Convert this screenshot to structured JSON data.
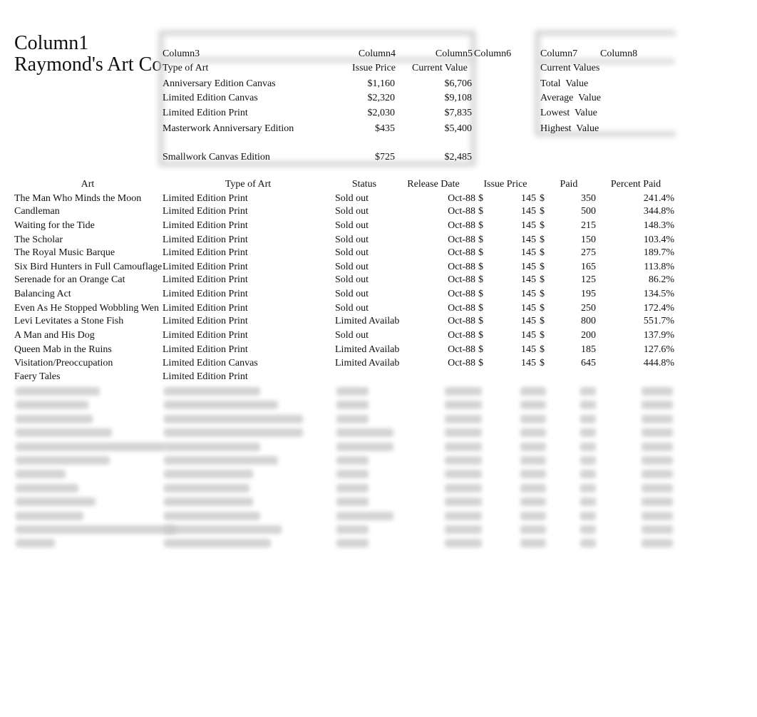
{
  "header": {
    "column1": "Column1",
    "company": "Raymond's Art Co"
  },
  "summary_left": {
    "column_headers": [
      "Column3",
      "Column4",
      "Column5",
      "Column6"
    ],
    "field_headers": [
      "Type of Art",
      "Issue Price",
      "Current Value"
    ],
    "rows": [
      {
        "type": "Anniversary Edition Canvas",
        "issue_price": "$1,160",
        "current_value": "$6,706"
      },
      {
        "type": "Limited Edition Canvas",
        "issue_price": "$2,320",
        "current_value": "$9,108"
      },
      {
        "type": "Limited Edition Print",
        "issue_price": "$2,030",
        "current_value": "$7,835"
      },
      {
        "type": "Masterwork Anniversary Edition",
        "issue_price": "$435",
        "current_value": "$5,400"
      },
      {
        "type": "Smallwork Canvas Edition",
        "issue_price": "$725",
        "current_value": "$2,485"
      }
    ]
  },
  "summary_right": {
    "column_headers": [
      "Column7",
      "Column8"
    ],
    "heading": "Current Values",
    "labels": [
      "Total  Value",
      "Average  Value",
      "Lowest  Value",
      "Highest  Value"
    ]
  },
  "table": {
    "headers": [
      "Art",
      "Type of Art",
      "Status",
      "Release Date",
      "Issue Price",
      "Paid",
      "Percent Paid"
    ],
    "currency_symbol": "$",
    "rows": [
      {
        "art": "The Man Who Minds the Moon",
        "type": "Limited Edition Print",
        "status": "Sold out",
        "release": "Oct-88",
        "issue": "145",
        "paid": "350",
        "pct": "241.4%"
      },
      {
        "art": "Candleman",
        "type": "Limited Edition Print",
        "status": "Sold out",
        "release": "Oct-88",
        "issue": "145",
        "paid": "500",
        "pct": "344.8%"
      },
      {
        "art": "Waiting for the Tide",
        "type": "Limited Edition Print",
        "status": "Sold out",
        "release": "Oct-88",
        "issue": "145",
        "paid": "215",
        "pct": "148.3%"
      },
      {
        "art": "The Scholar",
        "type": "Limited Edition Print",
        "status": "Sold out",
        "release": "Oct-88",
        "issue": "145",
        "paid": "150",
        "pct": "103.4%"
      },
      {
        "art": "The Royal Music Barque",
        "type": "Limited Edition Print",
        "status": "Sold out",
        "release": "Oct-88",
        "issue": "145",
        "paid": "275",
        "pct": "189.7%"
      },
      {
        "art": "Six Bird Hunters in Full Camouflage",
        "type": "Limited Edition Print",
        "status": "Sold out",
        "release": "Oct-88",
        "issue": "145",
        "paid": "165",
        "pct": "113.8%"
      },
      {
        "art": "Serenade for an Orange Cat",
        "type": "Limited Edition Print",
        "status": "Sold out",
        "release": "Oct-88",
        "issue": "145",
        "paid": "125",
        "pct": "86.2%"
      },
      {
        "art": "Balancing Act",
        "type": "Limited Edition Print",
        "status": "Sold out",
        "release": "Oct-88",
        "issue": "145",
        "paid": "195",
        "pct": "134.5%"
      },
      {
        "art": "Even As He Stopped Wobbling Wen",
        "type": "Limited Edition Print",
        "status": "Sold out",
        "release": "Oct-88",
        "issue": "145",
        "paid": "250",
        "pct": "172.4%"
      },
      {
        "art": "Levi Levitates a Stone Fish",
        "type": "Limited Edition Print",
        "status": "Limited Availab",
        "release": "Oct-88",
        "issue": "145",
        "paid": "800",
        "pct": "551.7%"
      },
      {
        "art": "A Man and His Dog",
        "type": "Limited Edition Print",
        "status": "Sold out",
        "release": "Oct-88",
        "issue": "145",
        "paid": "200",
        "pct": "137.9%"
      },
      {
        "art": "Queen Mab in the Ruins",
        "type": "Limited Edition Print",
        "status": "Limited Availab",
        "release": "Oct-88",
        "issue": "145",
        "paid": "185",
        "pct": "127.6%"
      },
      {
        "art": "Visitation/Preoccupation",
        "type": "Limited Edition Canvas",
        "status": "Limited Availab",
        "release": "Oct-88",
        "issue": "145",
        "paid": "645",
        "pct": "444.8%"
      },
      {
        "art": "Faery Tales",
        "type": "Limited Edition Print",
        "status": "",
        "release": "",
        "issue": "",
        "paid": "",
        "pct": ""
      }
    ]
  }
}
